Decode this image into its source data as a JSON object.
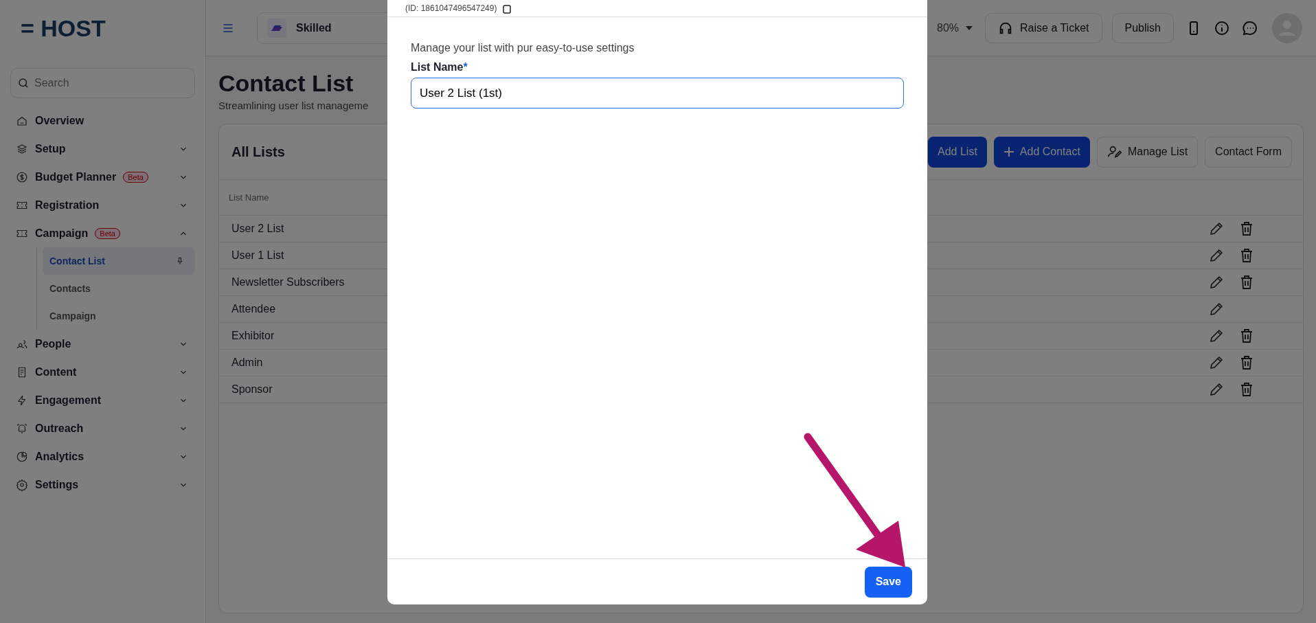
{
  "sidebar": {
    "logo": "= HOST",
    "search": {
      "placeholder": "Search"
    },
    "items": [
      {
        "label": "Overview"
      },
      {
        "label": "Setup",
        "expanded": false
      },
      {
        "label": "Budget Planner",
        "badge": "Beta",
        "expanded": false
      },
      {
        "label": "Registration",
        "expanded": false
      },
      {
        "label": "Campaign",
        "badge": "Beta",
        "expanded": true,
        "children": [
          {
            "label": "Contact List",
            "selected": true
          },
          {
            "label": "Contacts",
            "selected": false
          },
          {
            "label": "Campaign",
            "selected": false
          }
        ]
      },
      {
        "label": "People",
        "expanded": false
      },
      {
        "label": "Content",
        "expanded": false
      },
      {
        "label": "Engagement",
        "expanded": false
      },
      {
        "label": "Outreach",
        "expanded": false
      },
      {
        "label": "Analytics",
        "expanded": false
      },
      {
        "label": "Settings",
        "expanded": false
      }
    ]
  },
  "topbar": {
    "event": "Skilled",
    "zoom": "80%",
    "raise_ticket": "Raise a Ticket",
    "publish": "Publish"
  },
  "page": {
    "title": "Contact List",
    "subtitle": "Streamlining user list manageme"
  },
  "card": {
    "title": "All Lists",
    "buttons": [
      {
        "label": "Add List",
        "kind": "primary"
      },
      {
        "label": "Add Contact",
        "kind": "primary-plus"
      },
      {
        "label": "Manage List",
        "kind": "outline-icon"
      },
      {
        "label": "Contact Form",
        "kind": "outline"
      }
    ],
    "column": "List Name",
    "rows": [
      {
        "name": "User 2 List",
        "deletable": true
      },
      {
        "name": "User 1 List",
        "deletable": true
      },
      {
        "name": "Newsletter Subscribers",
        "deletable": true
      },
      {
        "name": "Attendee",
        "deletable": false
      },
      {
        "name": "Exhibitor",
        "deletable": true
      },
      {
        "name": "Admin",
        "deletable": true
      },
      {
        "name": "Sponsor",
        "deletable": true
      }
    ]
  },
  "modal": {
    "id_text": "(ID: 1861047496547249)",
    "description": "Manage your list with pur easy-to-use settings",
    "field_label": "List Name",
    "required_mark": "*",
    "field_value": "User 2 List (1st)",
    "save": "Save"
  }
}
